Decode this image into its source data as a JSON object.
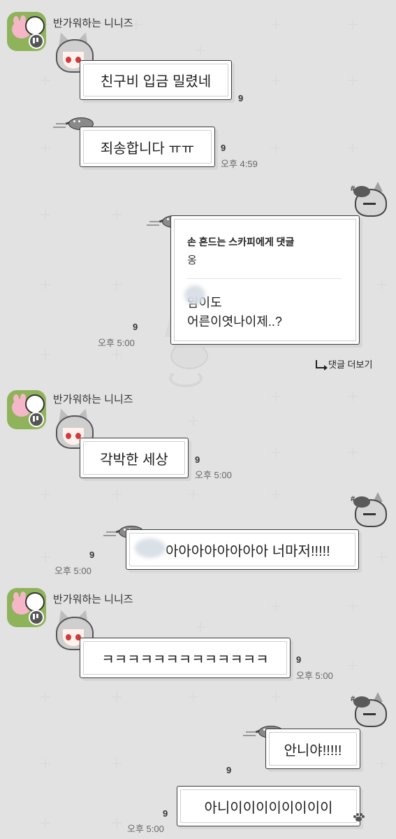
{
  "chat": {
    "sender_name": "반가워하는 니니즈",
    "unread_count": "9",
    "messages": [
      {
        "text": "친구비 입금 밀렸네",
        "time": ""
      },
      {
        "text": "죄송합니다 ㅠㅠ",
        "time": "오후 4:59"
      },
      {
        "text": "각박한 세상",
        "time": "오후 5:00"
      },
      {
        "text": "아아아아아아아아 너마저!!!!!",
        "time": "오후 5:00"
      },
      {
        "text": "ㅋㅋㅋㅋㅋㅋㅋㅋㅋㅋㅋㅋㅋ",
        "time": "오후 5:00"
      },
      {
        "text": "안니야!!!!!",
        "time": ""
      },
      {
        "text": "아니이이이이이이이이",
        "time": "오후 5:00"
      }
    ],
    "reply": {
      "title": "손 흔드는 스카피에게 댓글",
      "original": "옹",
      "line1": "암이도",
      "line2": "어른이엿나이제..?",
      "time": "오후 5:00"
    },
    "more_replies_label": "댓글 더보기"
  },
  "icons": [
    "group-profile-icon",
    "avatar-wolf-boy",
    "sticker-gray-cat",
    "sticker-boy-head",
    "reply-arrow-icon",
    "paw-icon"
  ],
  "colors": {
    "background": "#f6f6f6",
    "bubble_border": "#3a3a3a",
    "group_icon": "#8fb35a"
  }
}
